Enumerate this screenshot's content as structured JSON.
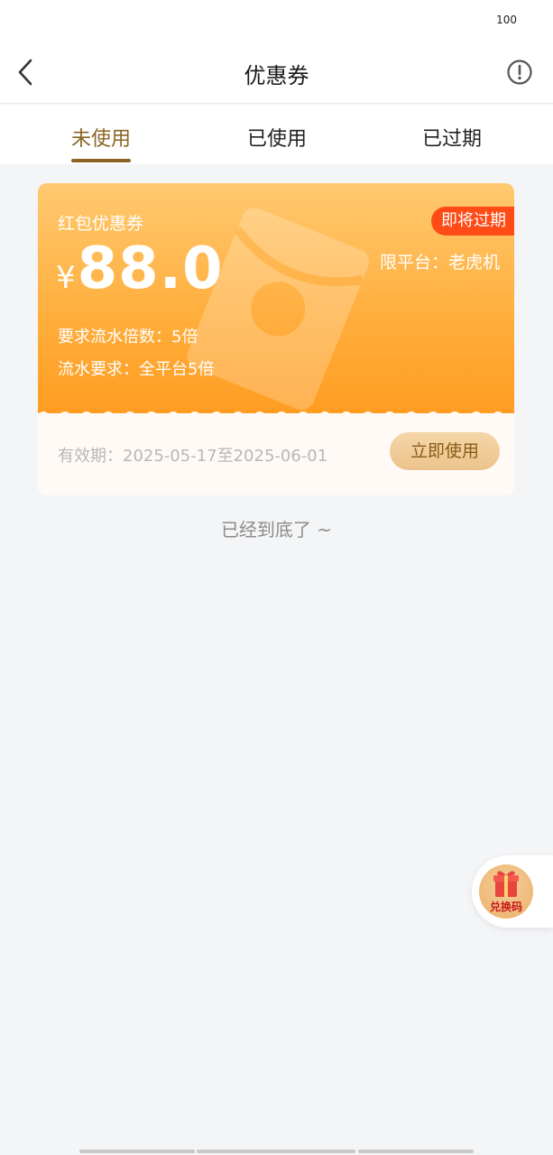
{
  "status_bar": {
    "battery": "100"
  },
  "header": {
    "title": "优惠券",
    "back_icon": "chevron-left-icon",
    "info_icon": "info-circle-icon"
  },
  "tabs": [
    {
      "label": "未使用",
      "active": true
    },
    {
      "label": "已使用",
      "active": false
    },
    {
      "label": "已过期",
      "active": false
    }
  ],
  "coupon": {
    "type": "红包优惠券",
    "currency": "¥",
    "amount": "88.0",
    "badge": "即将过期",
    "platform": "限平台：老虎机",
    "multiplier": "要求流水倍数：5倍",
    "flow_requirement": "流水要求：全平台5倍",
    "validity": "有效期：2025-05-17至2025-06-01",
    "use_button": "立即使用"
  },
  "footer_text": "已经到底了 ~",
  "redeem": {
    "label": "兑换码",
    "icon": "gift-icon"
  },
  "colors": {
    "accent": "#8a6524",
    "coupon_orange": "#ffae3c",
    "badge_red": "#ff4b16",
    "background": "#f4f5f7"
  }
}
